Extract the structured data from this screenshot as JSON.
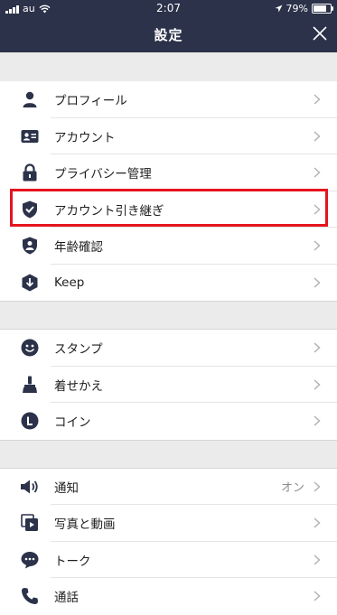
{
  "status_bar": {
    "carrier": "au",
    "time": "2:07",
    "battery": "79%",
    "battery_level": 0.79
  },
  "header": {
    "title": "設定"
  },
  "groups": [
    {
      "items": [
        {
          "label": "プロフィール",
          "icon": "person-icon"
        },
        {
          "label": "アカウント",
          "icon": "id-card-icon"
        },
        {
          "label": "プライバシー管理",
          "icon": "lock-icon"
        },
        {
          "label": "アカウント引き継ぎ",
          "icon": "shield-check-icon"
        },
        {
          "label": "年齢確認",
          "icon": "shield-person-icon"
        },
        {
          "label": "Keep",
          "icon": "keep-icon"
        }
      ]
    },
    {
      "items": [
        {
          "label": "スタンプ",
          "icon": "smiley-icon"
        },
        {
          "label": "着せかえ",
          "icon": "brush-icon"
        },
        {
          "label": "コイン",
          "icon": "coin-icon"
        }
      ]
    },
    {
      "items": [
        {
          "label": "通知",
          "value": "オン",
          "icon": "speaker-icon"
        },
        {
          "label": "写真と動画",
          "icon": "photo-video-icon"
        },
        {
          "label": "トーク",
          "icon": "chat-icon"
        },
        {
          "label": "通話",
          "icon": "phone-icon"
        }
      ]
    }
  ],
  "colors": {
    "header_bg": "#2b3249",
    "icon": "#2b3249",
    "highlight": "#e5141e"
  }
}
